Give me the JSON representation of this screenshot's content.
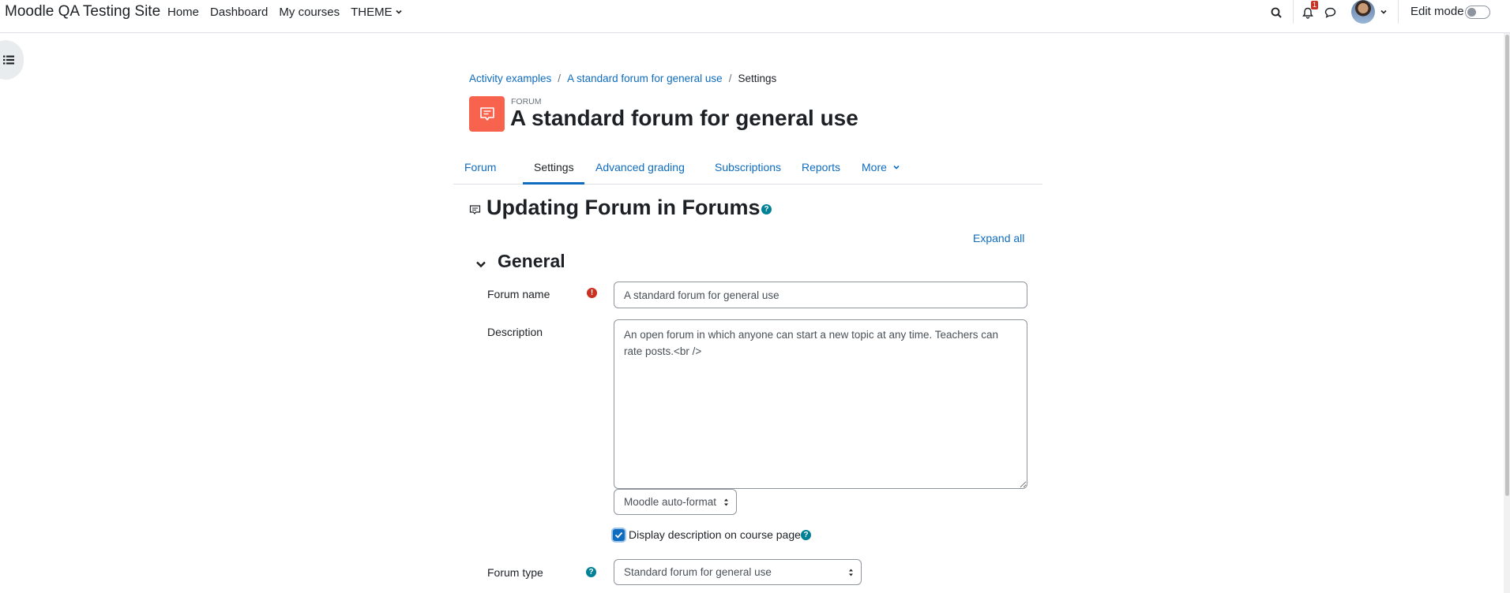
{
  "navbar": {
    "site_name": "Moodle QA Testing Site",
    "links": [
      "Home",
      "Dashboard",
      "My courses",
      "THEME"
    ],
    "notification_count": "1",
    "edit_mode_label": "Edit mode",
    "edit_mode_on": false
  },
  "breadcrumb": {
    "items": [
      "Activity examples",
      "A standard forum for general use"
    ],
    "current": "Settings"
  },
  "header": {
    "activity_type": "FORUM",
    "title": "A standard forum for general use"
  },
  "tabs": [
    "Forum",
    "Settings",
    "Advanced grading",
    "Subscriptions",
    "Reports",
    "More"
  ],
  "active_tab": "Settings",
  "form": {
    "heading": "Updating Forum in Forums",
    "expand_all": "Expand all",
    "section_title": "General",
    "forum_name_label": "Forum name",
    "forum_name_value": "A standard forum for general use",
    "description_label": "Description",
    "description_value": "An open forum in which anyone can start a new topic at any time. Teachers can rate posts.<br />",
    "format_select": "Moodle auto-format",
    "display_description_label": "Display description on course page",
    "display_description_checked": true,
    "forum_type_label": "Forum type",
    "forum_type_value": "Standard forum for general use"
  },
  "colors": {
    "link": "#0f6cbf",
    "forum_icon_bg": "#f7634d",
    "help_icon": "#008196",
    "required_icon": "#ca3120"
  }
}
